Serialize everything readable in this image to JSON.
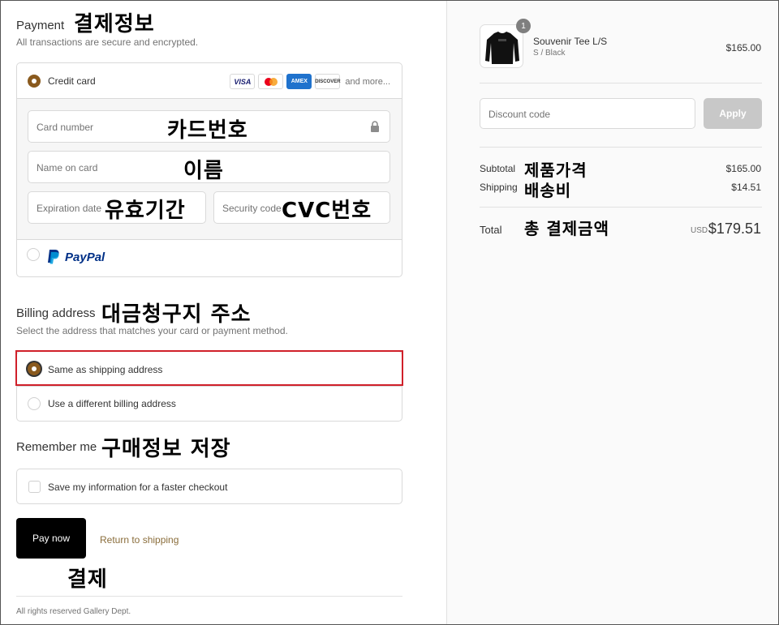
{
  "payment": {
    "title": "Payment",
    "subtitle": "All transactions are secure and encrypted.",
    "annotation": "결제정보",
    "credit_card_label": "Credit card",
    "card_logos": [
      "VISA",
      "MC",
      "AMEX",
      "DISCOVER"
    ],
    "and_more": "and more...",
    "card_number_placeholder": "Card number",
    "card_number_annotation": "카드번호",
    "name_placeholder": "Name on card",
    "name_annotation": "이름",
    "expiration_placeholder": "Expiration date",
    "expiration_annotation": "유효기간",
    "security_placeholder": "Security code",
    "security_annotation": "CVC번호",
    "paypal_label": "PayPal"
  },
  "billing": {
    "title": "Billing address",
    "annotation": "대금청구지 주소",
    "subtitle": "Select the address that matches your card or payment method.",
    "option_same": "Same as shipping address",
    "option_different": "Use a different billing address"
  },
  "remember": {
    "title": "Remember me",
    "annotation": "구매정보 저장",
    "checkbox_label": "Save my information for a faster checkout"
  },
  "actions": {
    "pay_now": "Pay now",
    "pay_annotation": "결제",
    "return_link": "Return to shipping"
  },
  "footer": {
    "text": "All rights reserved Gallery Dept."
  },
  "order": {
    "quantity": "1",
    "product_name": "Souvenir Tee L/S",
    "variant": "S / Black",
    "product_price": "$165.00",
    "discount_placeholder": "Discount code",
    "apply_label": "Apply",
    "subtotal_label": "Subtotal",
    "subtotal_annotation": "제품가격",
    "subtotal_value": "$165.00",
    "shipping_label": "Shipping",
    "shipping_annotation": "배송비",
    "shipping_value": "$14.51",
    "total_label": "Total",
    "total_annotation": "총 결제금액",
    "currency": "USD",
    "total_value": "$179.51"
  },
  "colors": {
    "accent": "#8a5a1e",
    "highlight_border": "#d0202a",
    "paypal_dark": "#003087",
    "paypal_light": "#009cde"
  }
}
